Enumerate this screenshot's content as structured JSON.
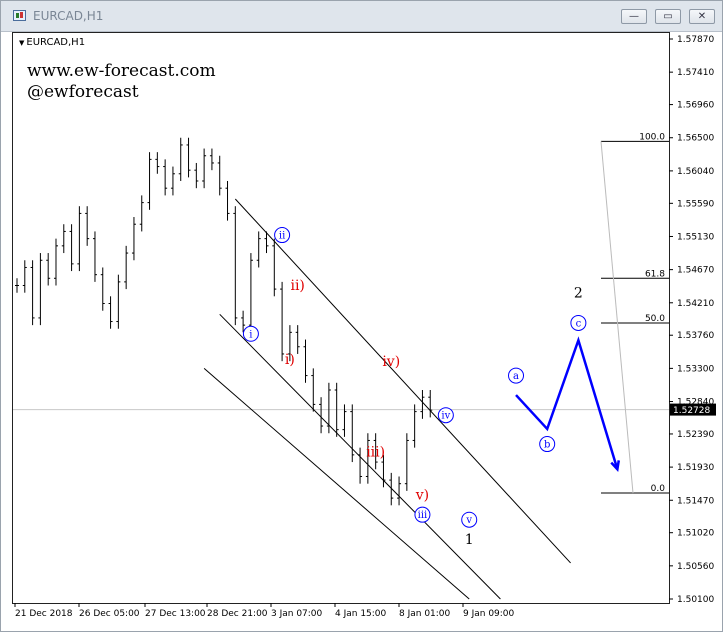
{
  "window": {
    "title": "EURCAD,H1",
    "buttons": [
      "minimize",
      "restore",
      "close"
    ],
    "button_glyphs": [
      "—",
      "▭",
      "✕"
    ]
  },
  "chart_header": {
    "symbol": "EURCAD,H1"
  },
  "watermark": {
    "line1": "www.ew-forecast.com",
    "line2": "@ewforecast"
  },
  "colors": {
    "bull": "#000000",
    "blue": "#0000ff",
    "red": "#e00000",
    "current_price_bg": "#000000"
  },
  "chart_data": {
    "type": "candlestick",
    "title": "",
    "xlabel": "",
    "ylabel": "",
    "ylim": [
      1.501,
      1.5787
    ],
    "y_ticks": [
      "1.57870",
      "1.57410",
      "1.56960",
      "1.56500",
      "1.56040",
      "1.55590",
      "1.55130",
      "1.54670",
      "1.54210",
      "1.53760",
      "1.53300",
      "1.52840",
      "1.52390",
      "1.51930",
      "1.51470",
      "1.51020",
      "1.50560",
      "1.50100"
    ],
    "x_ticks": [
      "21 Dec 2018",
      "26 Dec 05:00",
      "27 Dec 13:00",
      "28 Dec 21:00",
      "3 Jan 07:00",
      "4 Jan 15:00",
      "8 Jan 01:00",
      "9 Jan 09:00"
    ],
    "current_price": "1.52728",
    "price_path": [
      1.5445,
      1.547,
      1.54,
      1.548,
      1.5455,
      1.55,
      1.552,
      1.5475,
      1.5545,
      1.551,
      1.546,
      1.542,
      1.5395,
      1.545,
      1.549,
      1.553,
      1.556,
      1.562,
      1.561,
      1.558,
      1.56,
      1.564,
      1.5605,
      1.559,
      1.5625,
      1.5615,
      1.558,
      1.5545,
      1.54,
      1.539,
      1.548,
      1.551,
      1.55,
      1.544,
      1.535,
      1.538,
      1.536,
      1.532,
      1.528,
      1.525,
      1.53,
      1.5245,
      1.527,
      1.521,
      1.518,
      1.523,
      1.52,
      1.5175,
      1.515,
      1.517,
      1.523,
      1.527,
      1.529,
      1.5272
    ],
    "fibonacci": [
      {
        "label": "100.0",
        "price": 1.5645
      },
      {
        "label": "61.8",
        "price": 1.5455
      },
      {
        "label": "50.0",
        "price": 1.5393
      },
      {
        "label": "0.0",
        "price": 1.5157
      }
    ],
    "wave_labels": [
      {
        "text": "ii",
        "circled": true,
        "color": "blue",
        "price": 1.5515,
        "bar": 34
      },
      {
        "text": "i",
        "circled": true,
        "color": "blue",
        "price": 1.5378,
        "bar": 30
      },
      {
        "text": "ii)",
        "circled": false,
        "color": "red",
        "price": 1.5446,
        "bar": 36
      },
      {
        "text": "i)",
        "circled": false,
        "color": "red",
        "price": 1.5343,
        "bar": 35
      },
      {
        "text": "iv)",
        "circled": false,
        "color": "red",
        "price": 1.534,
        "bar": 48
      },
      {
        "text": "iii)",
        "circled": false,
        "color": "red",
        "price": 1.5215,
        "bar": 46
      },
      {
        "text": "iv",
        "circled": true,
        "color": "blue",
        "price": 1.5265,
        "bar": 55
      },
      {
        "text": "v)",
        "circled": false,
        "color": "red",
        "price": 1.5155,
        "bar": 52
      },
      {
        "text": "iii",
        "circled": true,
        "color": "blue",
        "price": 1.5127,
        "bar": 52
      },
      {
        "text": "v",
        "circled": true,
        "color": "blue",
        "price": 1.512,
        "bar": 58
      },
      {
        "text": "1",
        "circled": false,
        "color": "black",
        "price": 1.5093,
        "bar": 58
      },
      {
        "text": "a",
        "circled": true,
        "color": "blue",
        "price": 1.532,
        "bar": 64
      },
      {
        "text": "b",
        "circled": true,
        "color": "blue",
        "price": 1.5225,
        "bar": 68
      },
      {
        "text": "c",
        "circled": true,
        "color": "blue",
        "price": 1.5393,
        "bar": 72
      },
      {
        "text": "2",
        "circled": false,
        "color": "black",
        "price": 1.5435,
        "bar": 72
      }
    ],
    "projection": [
      {
        "bar": 64,
        "price": 1.5293
      },
      {
        "bar": 68,
        "price": 1.5246
      },
      {
        "bar": 72,
        "price": 1.5369
      },
      {
        "bar": 77,
        "price": 1.519
      }
    ]
  }
}
